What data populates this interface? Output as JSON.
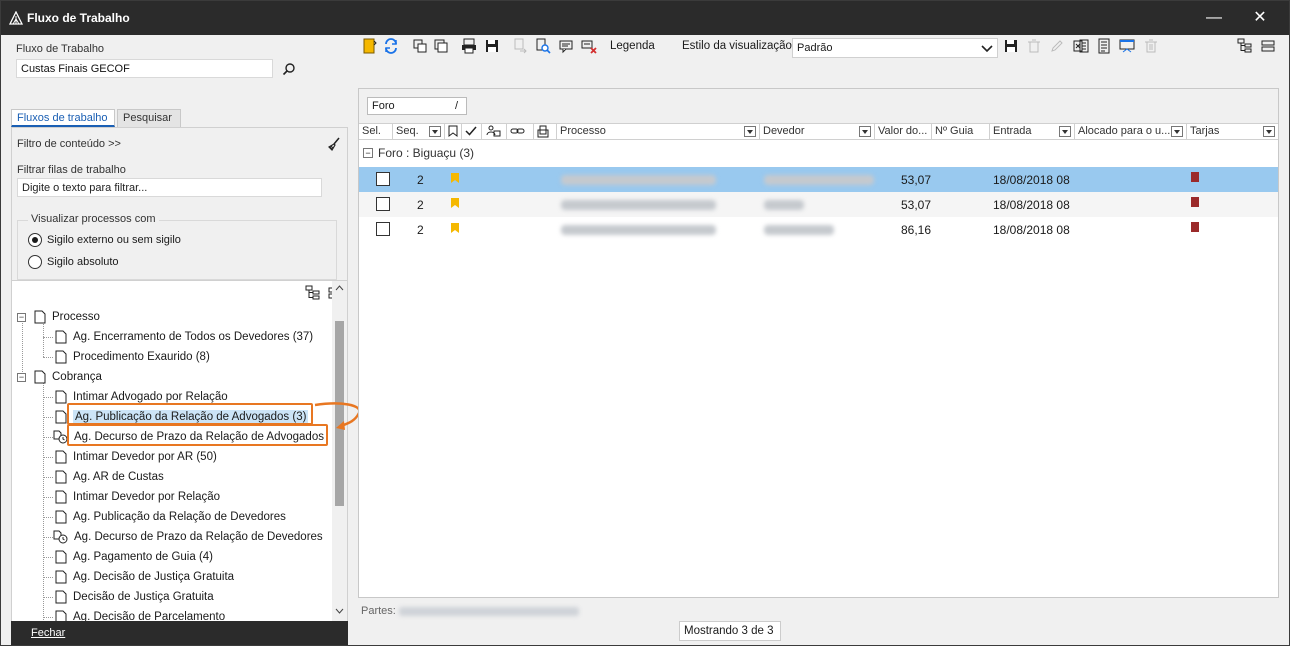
{
  "window": {
    "title": "Fluxo de Trabalho",
    "minimize": "—",
    "close": "✕"
  },
  "left": {
    "fluxo_label": "Fluxo de Trabalho",
    "fluxo_value": "Custas Finais GECOF",
    "tabs": [
      {
        "label": "Fluxos de trabalho",
        "active": true
      },
      {
        "label": "Pesquisar",
        "active": false
      }
    ],
    "filtro_conteudo": "Filtro de conteúdo >>",
    "filtrar_label": "Filtrar filas de trabalho",
    "filtrar_placeholder": "Digite o texto para filtrar...",
    "visualizar_legend": "Visualizar processos com",
    "radio_options": [
      {
        "label": "Sigilo externo ou sem sigilo",
        "checked": true
      },
      {
        "label": "Sigilo absoluto",
        "checked": false
      }
    ],
    "tree": [
      {
        "label": "Processo",
        "level": 0,
        "icon": "document-icon",
        "expander": "−"
      },
      {
        "label": "Ag. Encerramento de Todos os Devedores (37)",
        "level": 1,
        "icon": "document-icon"
      },
      {
        "label": "Procedimento Exaurido (8)",
        "level": 1,
        "icon": "document-icon"
      },
      {
        "label": "Cobrança",
        "level": 0,
        "icon": "document-icon",
        "expander": "−"
      },
      {
        "label": "Intimar Advogado por Relação",
        "level": 1,
        "icon": "document-icon"
      },
      {
        "label": "Ag. Publicação da Relação de Advogados (3)",
        "level": 1,
        "icon": "document-icon",
        "selected": true
      },
      {
        "label": "Ag. Decurso de Prazo da Relação de Advogados",
        "level": 1,
        "icon": "timer-icon"
      },
      {
        "label": "Intimar Devedor por AR (50)",
        "level": 1,
        "icon": "document-icon"
      },
      {
        "label": "Ag. AR de Custas",
        "level": 1,
        "icon": "document-icon"
      },
      {
        "label": "Intimar Devedor por Relação",
        "level": 1,
        "icon": "document-icon"
      },
      {
        "label": "Ag. Publicação da Relação de Devedores",
        "level": 1,
        "icon": "document-icon"
      },
      {
        "label": "Ag. Decurso de Prazo da Relação de Devedores",
        "level": 1,
        "icon": "timer-icon"
      },
      {
        "label": "Ag. Pagamento de Guia (4)",
        "level": 1,
        "icon": "document-icon"
      },
      {
        "label": "Ag. Decisão de Justiça Gratuita",
        "level": 1,
        "icon": "document-icon"
      },
      {
        "label": "Decisão de Justiça Gratuita",
        "level": 1,
        "icon": "document-icon"
      },
      {
        "label": "Ag. Decisão de Parcelamento",
        "level": 1,
        "icon": "document-icon"
      }
    ],
    "fechar": "Fechar"
  },
  "toolbar": {
    "legenda": "Legenda",
    "estilo_label": "Estilo da visualização",
    "estilo_value": "Padrão"
  },
  "grid": {
    "group_chip": "Foro",
    "group_chip_sort": "/",
    "columns": [
      "Sel.",
      "Seq.",
      "Processo",
      "Devedor",
      "Valor do...",
      "Nº Guia",
      "Entrada",
      "Alocado para o u...",
      "Tarjas"
    ],
    "group_row": "Foro : Biguaçu  (3)",
    "group_expander": "−",
    "rows": [
      {
        "seq": "2",
        "valor": "53,07",
        "entrada": "18/08/2018 08",
        "selected": true
      },
      {
        "seq": "2",
        "valor": "53,07",
        "entrada": "18/08/2018 08",
        "selected": false
      },
      {
        "seq": "2",
        "valor": "86,16",
        "entrada": "18/08/2018 08",
        "selected": false
      }
    ]
  },
  "footer": {
    "partes_label": "Partes:",
    "status": "Mostrando 3 de 3"
  },
  "colors": {
    "accent_highlight": "#e87722",
    "selection": "#99c9ef",
    "titlebar": "#2b2b2b",
    "flag": "#f5b800",
    "tarja": "#9b2a2a"
  }
}
